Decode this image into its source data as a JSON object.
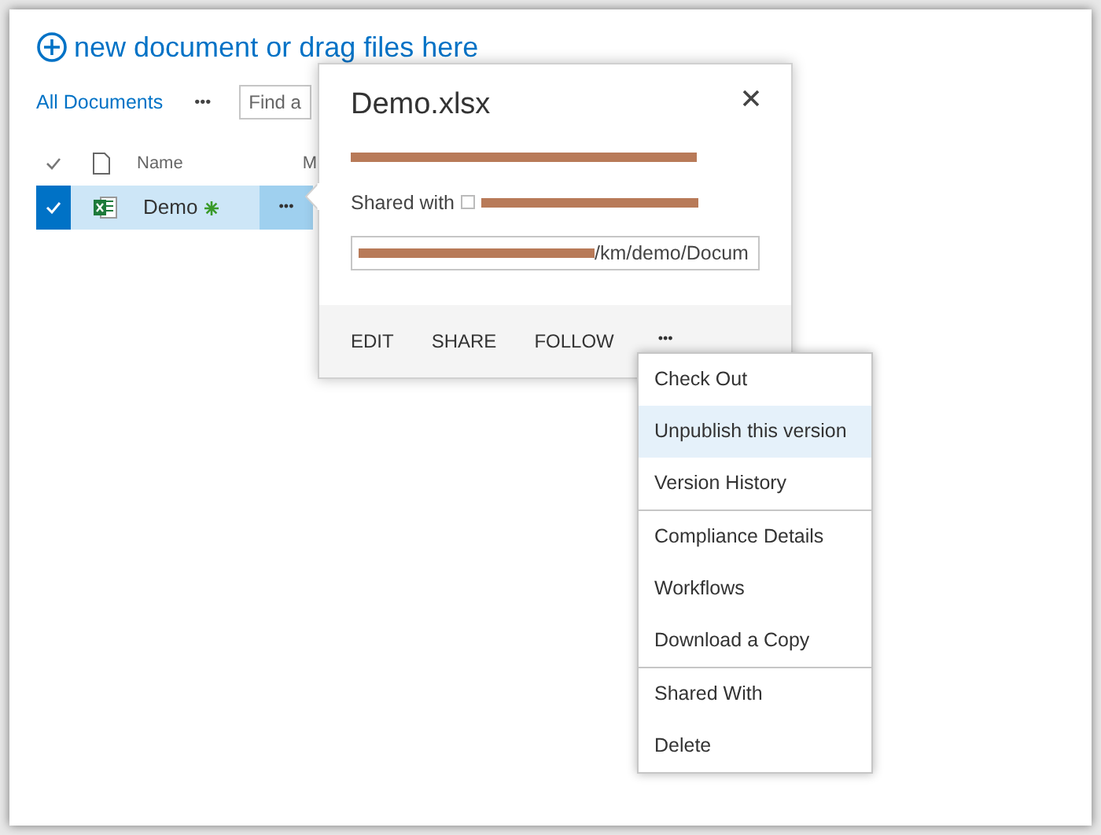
{
  "header": {
    "new_document": "new document or drag files here"
  },
  "toolbar": {
    "view": "All Documents",
    "more": "•••",
    "search": {
      "placeholder": "Find a"
    }
  },
  "table": {
    "columns": [
      {
        "label": "Name"
      },
      {
        "label": "M"
      }
    ],
    "rows": [
      {
        "name": "Demo",
        "selected": true,
        "more": "•••"
      }
    ]
  },
  "callout": {
    "title": "Demo.xlsx",
    "shared_with": "Shared with",
    "url": "/km/demo/Docum",
    "actions": [
      {
        "label": "EDIT"
      },
      {
        "label": "SHARE"
      },
      {
        "label": "FOLLOW"
      },
      {
        "label": "•••"
      }
    ]
  },
  "menu": {
    "groups": [
      [
        {
          "label": "Check Out",
          "selected": false
        },
        {
          "label": "Unpublish this version",
          "selected": true
        },
        {
          "label": "Version History",
          "selected": false
        }
      ],
      [
        {
          "label": "Compliance Details",
          "selected": false
        },
        {
          "label": "Workflows",
          "selected": false
        },
        {
          "label": "Download a Copy",
          "selected": false
        }
      ],
      [
        {
          "label": "Shared With",
          "selected": false
        },
        {
          "label": "Delete",
          "selected": false
        }
      ]
    ]
  }
}
